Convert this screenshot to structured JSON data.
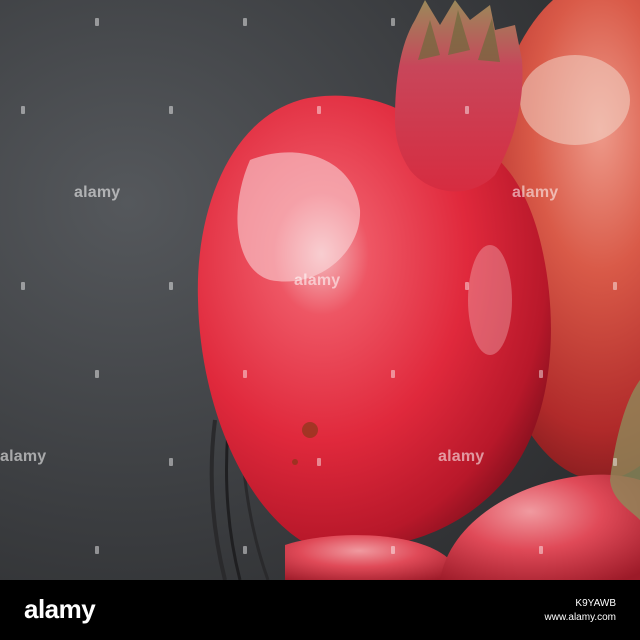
{
  "watermark": {
    "brand": "alamy",
    "image_id": "K9YAWB",
    "url": "www.alamy.com"
  },
  "photo": {
    "subject": "pomegranates",
    "background_color": "#3b3d40",
    "fruit_color": "#d92a3a"
  }
}
